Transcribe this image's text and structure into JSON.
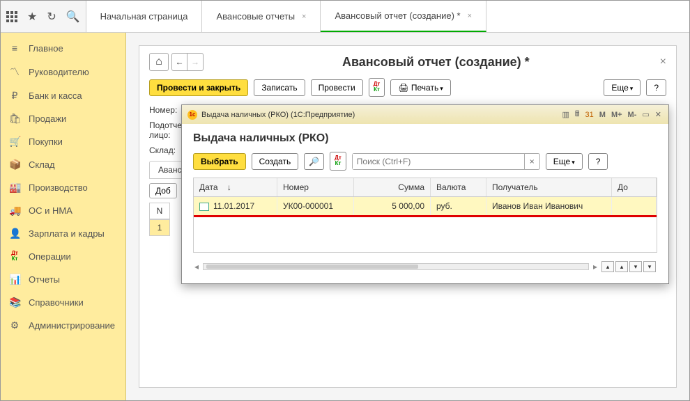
{
  "tabs": {
    "home": "Начальная страница",
    "expense_reports": "Авансовые отчеты",
    "expense_report_new": "Авансовый отчет (создание) *"
  },
  "sidebar": {
    "items": [
      {
        "icon": "≡",
        "label": "Главное"
      },
      {
        "icon": "📈",
        "label": "Руководителю"
      },
      {
        "icon": "₽",
        "label": "Банк и касса"
      },
      {
        "icon": "🛍",
        "label": "Продажи"
      },
      {
        "icon": "🛒",
        "label": "Покупки"
      },
      {
        "icon": "📦",
        "label": "Склад"
      },
      {
        "icon": "🏭",
        "label": "Производство"
      },
      {
        "icon": "🚚",
        "label": "ОС и НМА"
      },
      {
        "icon": "👤",
        "label": "Зарплата и кадры"
      },
      {
        "icon": "Дт",
        "label": "Операции"
      },
      {
        "icon": "📊",
        "label": "Отчеты"
      },
      {
        "icon": "📚",
        "label": "Справочники"
      },
      {
        "icon": "⚙",
        "label": "Администрирование"
      }
    ]
  },
  "page": {
    "title": "Авансовый отчет (создание) *",
    "buttons": {
      "post_close": "Провести и закрыть",
      "save": "Записать",
      "post": "Провести",
      "print": "Печать",
      "more": "Еще",
      "help": "?"
    },
    "labels": {
      "number": "Номер:",
      "person": "Подотчетное лицо:",
      "warehouse": "Склад:",
      "advances_tab": "Аванс",
      "add_btn": "Доб",
      "col_n": "N",
      "row_1": "1"
    }
  },
  "modal": {
    "window_title": "Выдача наличных (РКО)  (1С:Предприятие)",
    "heading": "Выдача наличных (РКО)",
    "buttons": {
      "select": "Выбрать",
      "create": "Создать",
      "more": "Еще",
      "help": "?"
    },
    "search_placeholder": "Поиск (Ctrl+F)",
    "memory_buttons": [
      "M",
      "M+",
      "M-"
    ],
    "columns": {
      "date": "Дата",
      "number": "Номер",
      "sum": "Сумма",
      "currency": "Валюта",
      "recipient": "Получатель",
      "extra": "До"
    },
    "row": {
      "date": "11.01.2017",
      "number": "УК00-000001",
      "sum": "5 000,00",
      "currency": "руб.",
      "recipient": "Иванов Иван Иванович"
    }
  }
}
